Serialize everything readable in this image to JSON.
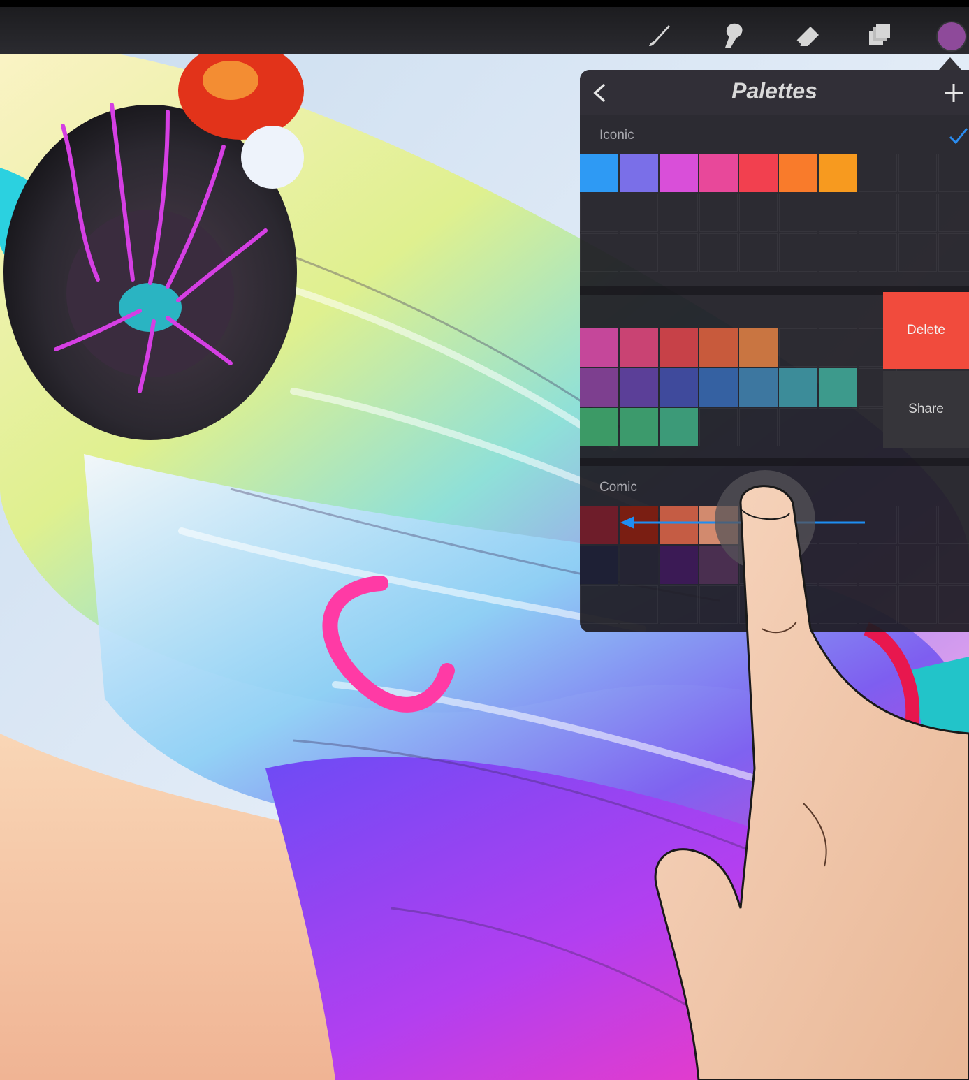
{
  "toolbar": {
    "tools": [
      {
        "name": "brush-icon"
      },
      {
        "name": "smudge-icon"
      },
      {
        "name": "eraser-icon"
      },
      {
        "name": "layers-icon"
      }
    ],
    "current_color": "#8e4a9a"
  },
  "palettes_panel": {
    "title": "Palettes",
    "sections": [
      {
        "label": "Iconic",
        "is_default": true,
        "swatches": [
          "#2e9af4",
          "#7a6fe8",
          "#d94fd9",
          "#e8489a",
          "#f2404f",
          "#f97b2b",
          "#f79a1f"
        ]
      },
      {
        "label": "",
        "swatch_rows": [
          [
            "#c5479a",
            "#c94373",
            "#c74148",
            "#c85a3c",
            "#c97541"
          ],
          [
            "#7d3f8f",
            "#5b3f98",
            "#3f4a9c",
            "#3561a2",
            "#3d77a0",
            "#3c8c99",
            "#3d9a8c"
          ],
          [
            "#3c9a66",
            "#3c9a6c",
            "#3c9a78"
          ]
        ],
        "actions": {
          "delete": "Delete",
          "share": "Share"
        }
      },
      {
        "label": "Comic",
        "swatch_rows": [
          [
            "#6e1d2a",
            "#7a1e12",
            "#c55c44",
            "#d28a6e"
          ],
          [
            "#1e2035",
            "#252433",
            "#3b1a55",
            "#4a2f50"
          ]
        ]
      }
    ]
  }
}
